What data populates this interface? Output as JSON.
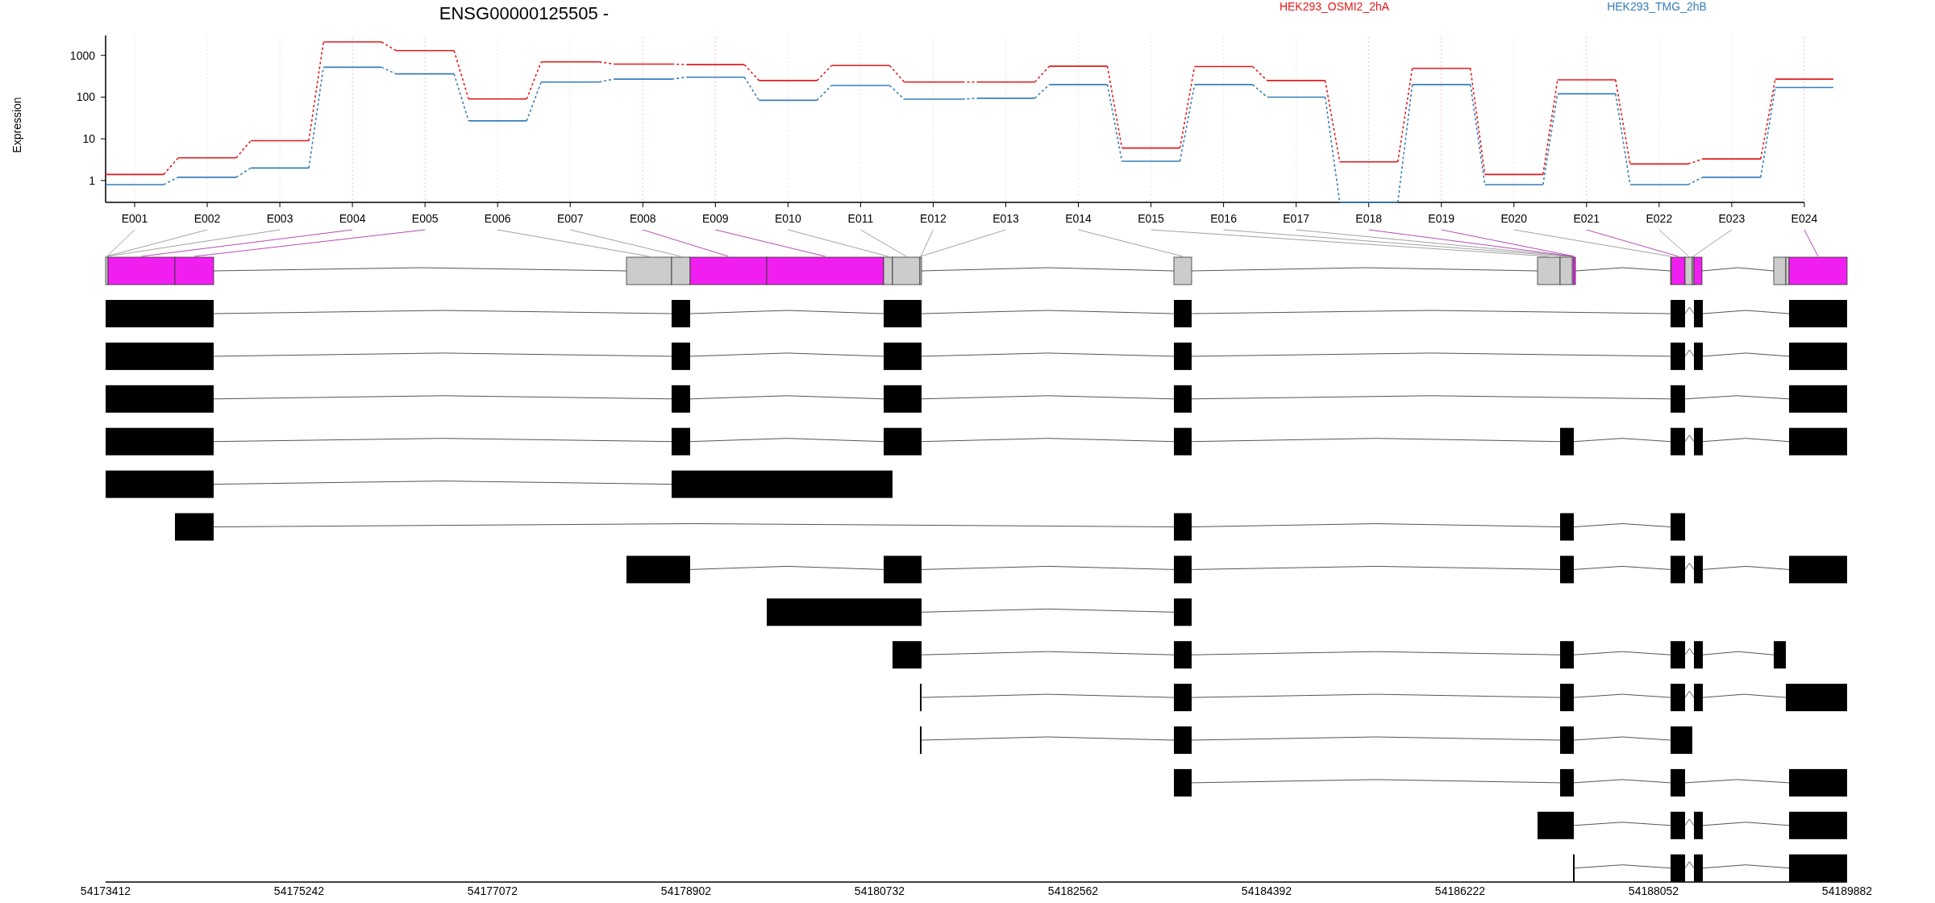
{
  "expression_plot": {
    "title": "ENSG00000125505 -",
    "ylabel": "Expression",
    "legend": [
      {
        "label": "HEK293_OSMI2_2hA",
        "color": "#e41a1c"
      },
      {
        "label": "HEK293_TMG_2hB",
        "color": "#377eb8"
      }
    ],
    "y_tick_labels": [
      "1000",
      "100",
      "10",
      "1"
    ],
    "x_tick_labels": [
      "E001",
      "E002",
      "E003",
      "E004",
      "E005",
      "E006",
      "E007",
      "E008",
      "E009",
      "E010",
      "E011",
      "E012",
      "E013",
      "E014",
      "E015",
      "E016",
      "E017",
      "E018",
      "E019",
      "E020",
      "E021",
      "E022",
      "E023",
      "E024"
    ]
  },
  "exons": [
    {
      "significant": false
    },
    {
      "significant": false
    },
    {
      "significant": false
    },
    {
      "significant": true
    },
    {
      "significant": true
    },
    {
      "significant": false
    },
    {
      "significant": false
    },
    {
      "significant": true
    },
    {
      "significant": true
    },
    {
      "significant": false
    },
    {
      "significant": false
    },
    {
      "significant": false
    },
    {
      "significant": false
    },
    {
      "significant": false
    },
    {
      "significant": false
    },
    {
      "significant": false
    },
    {
      "significant": false
    },
    {
      "significant": true
    },
    {
      "significant": true
    },
    {
      "significant": false
    },
    {
      "significant": true
    },
    {
      "significant": false
    },
    {
      "significant": false
    },
    {
      "significant": true
    }
  ],
  "genome_axis": {
    "ticks": [
      "54173412",
      "54175242",
      "54177072",
      "54178902",
      "54180732",
      "54182562",
      "54184392",
      "54186222",
      "54188052",
      "54189882"
    ]
  }
}
